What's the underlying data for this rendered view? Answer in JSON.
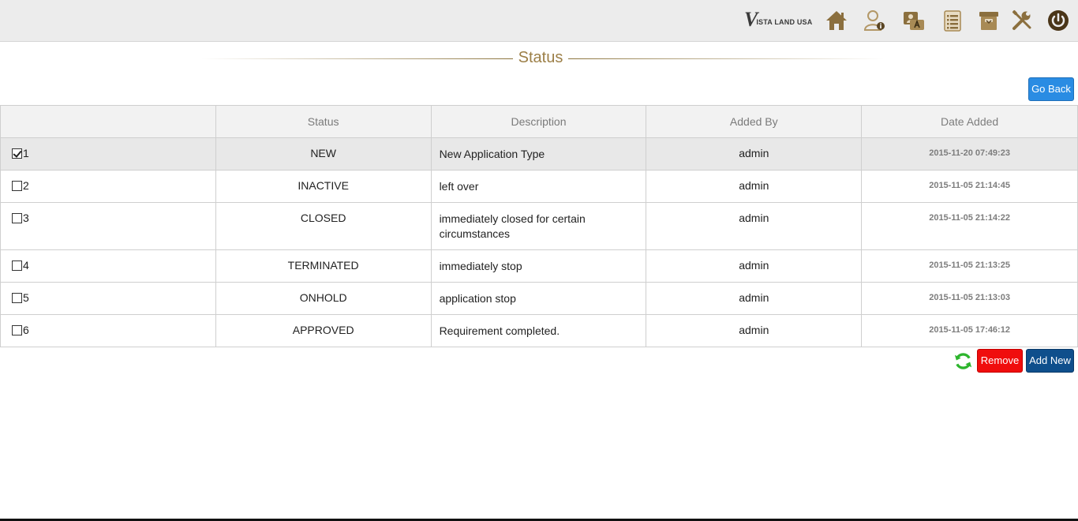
{
  "header": {
    "logo_mark": "V",
    "logo_text": "ISTA LAND USA",
    "icons": [
      "home-icon",
      "user-info-icon",
      "user-admin-icon",
      "list-icon",
      "archive-box-icon",
      "tools-icon",
      "power-icon"
    ],
    "icon_color": "#8b6f3e"
  },
  "page": {
    "title": "Status"
  },
  "buttons": {
    "go_back": "Go Back",
    "remove": "Remove",
    "add_new": "Add New"
  },
  "table": {
    "columns": [
      "",
      "Status",
      "Description",
      "Added By",
      "Date Added"
    ],
    "rows": [
      {
        "id": "1",
        "checked": true,
        "status": "NEW",
        "description": [
          "New Application Type"
        ],
        "added_by": "admin",
        "date_added": "2015-11-20 07:49:23"
      },
      {
        "id": "2",
        "checked": false,
        "status": "INACTIVE",
        "description": [
          "left over"
        ],
        "added_by": "admin",
        "date_added": "2015-11-05 21:14:45"
      },
      {
        "id": "3",
        "checked": false,
        "status": "CLOSED",
        "description": [
          "immediately closed for certain",
          "circumstances"
        ],
        "added_by": "admin",
        "date_added": "2015-11-05 21:14:22"
      },
      {
        "id": "4",
        "checked": false,
        "status": "TERMINATED",
        "description": [
          "immediately stop"
        ],
        "added_by": "admin",
        "date_added": "2015-11-05 21:13:25"
      },
      {
        "id": "5",
        "checked": false,
        "status": "ONHOLD",
        "description": [
          "application stop"
        ],
        "added_by": "admin",
        "date_added": "2015-11-05 21:13:03"
      },
      {
        "id": "6",
        "checked": false,
        "status": "APPROVED",
        "description": [
          "Requirement completed."
        ],
        "added_by": "admin",
        "date_added": "2015-11-05 17:46:12"
      }
    ]
  },
  "colors": {
    "go_back": "#2a8ce3",
    "remove": "#f00d0d",
    "add_new": "#0f4f8c",
    "title": "#9c7f47"
  }
}
